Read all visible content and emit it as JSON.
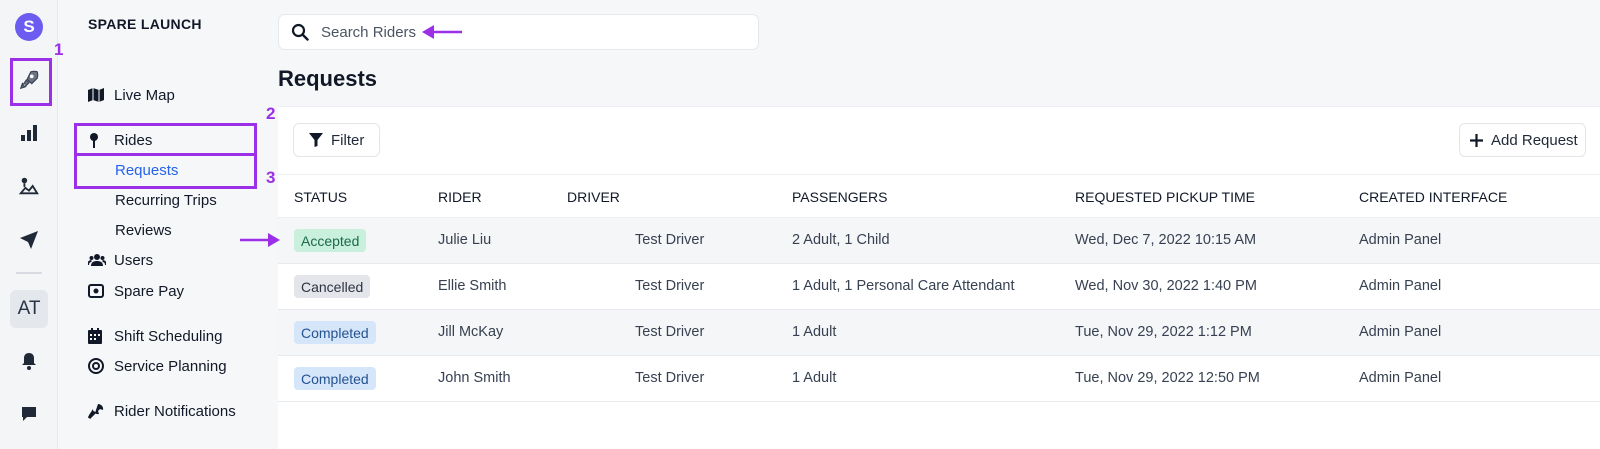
{
  "rail": {
    "logo_letter": "S",
    "avatar_initials": "AT",
    "icons": [
      "rocket-icon",
      "bar-chart-icon",
      "map-marker-icon",
      "send-icon",
      "bell-icon",
      "chat-icon"
    ]
  },
  "nav": {
    "org_name": "SPARE LAUNCH",
    "items": [
      {
        "label": "Live Map",
        "icon": "map-icon"
      },
      {
        "label": "Rides",
        "icon": "pin-icon"
      },
      {
        "label": "Requests",
        "sub": true,
        "active": true
      },
      {
        "label": "Recurring Trips",
        "sub": true
      },
      {
        "label": "Reviews",
        "sub": true
      },
      {
        "label": "Users",
        "icon": "users-icon"
      },
      {
        "label": "Spare Pay",
        "icon": "wallet-icon"
      },
      {
        "label": "Shift Scheduling",
        "icon": "calendar-icon"
      },
      {
        "label": "Service Planning",
        "icon": "target-icon"
      },
      {
        "label": "Rider Notifications",
        "icon": "wrench-icon"
      }
    ]
  },
  "annotations": [
    "1",
    "2",
    "3"
  ],
  "search": {
    "placeholder": "Search Riders"
  },
  "page_title": "Requests",
  "toolbar": {
    "filter_label": "Filter",
    "add_label": "Add Request"
  },
  "table": {
    "columns": [
      "STATUS",
      "RIDER",
      "DRIVER",
      "PASSENGERS",
      "REQUESTED PICKUP TIME",
      "CREATED INTERFACE"
    ],
    "rows": [
      {
        "status": "Accepted",
        "rider": "Julie Liu",
        "driver": "Test Driver",
        "passengers": "2 Adult, 1 Child",
        "pickup": "Wed, Dec 7, 2022 10:15 AM",
        "interface": "Admin Panel"
      },
      {
        "status": "Cancelled",
        "rider": "Ellie Smith",
        "driver": "Test Driver",
        "passengers": "1 Adult, 1 Personal Care Attendant",
        "pickup": "Wed, Nov 30, 2022 1:40 PM",
        "interface": "Admin Panel"
      },
      {
        "status": "Completed",
        "rider": "Jill McKay",
        "driver": "Test Driver",
        "passengers": "1 Adult",
        "pickup": "Tue, Nov 29, 2022 1:12 PM",
        "interface": "Admin Panel"
      },
      {
        "status": "Completed",
        "rider": "John Smith",
        "driver": "Test Driver",
        "passengers": "1 Adult",
        "pickup": "Tue, Nov 29, 2022 12:50 PM",
        "interface": "Admin Panel"
      }
    ]
  },
  "colors": {
    "annotation": "#9b30e8",
    "active_link": "#2563eb",
    "brand": "#6d5cf0"
  }
}
